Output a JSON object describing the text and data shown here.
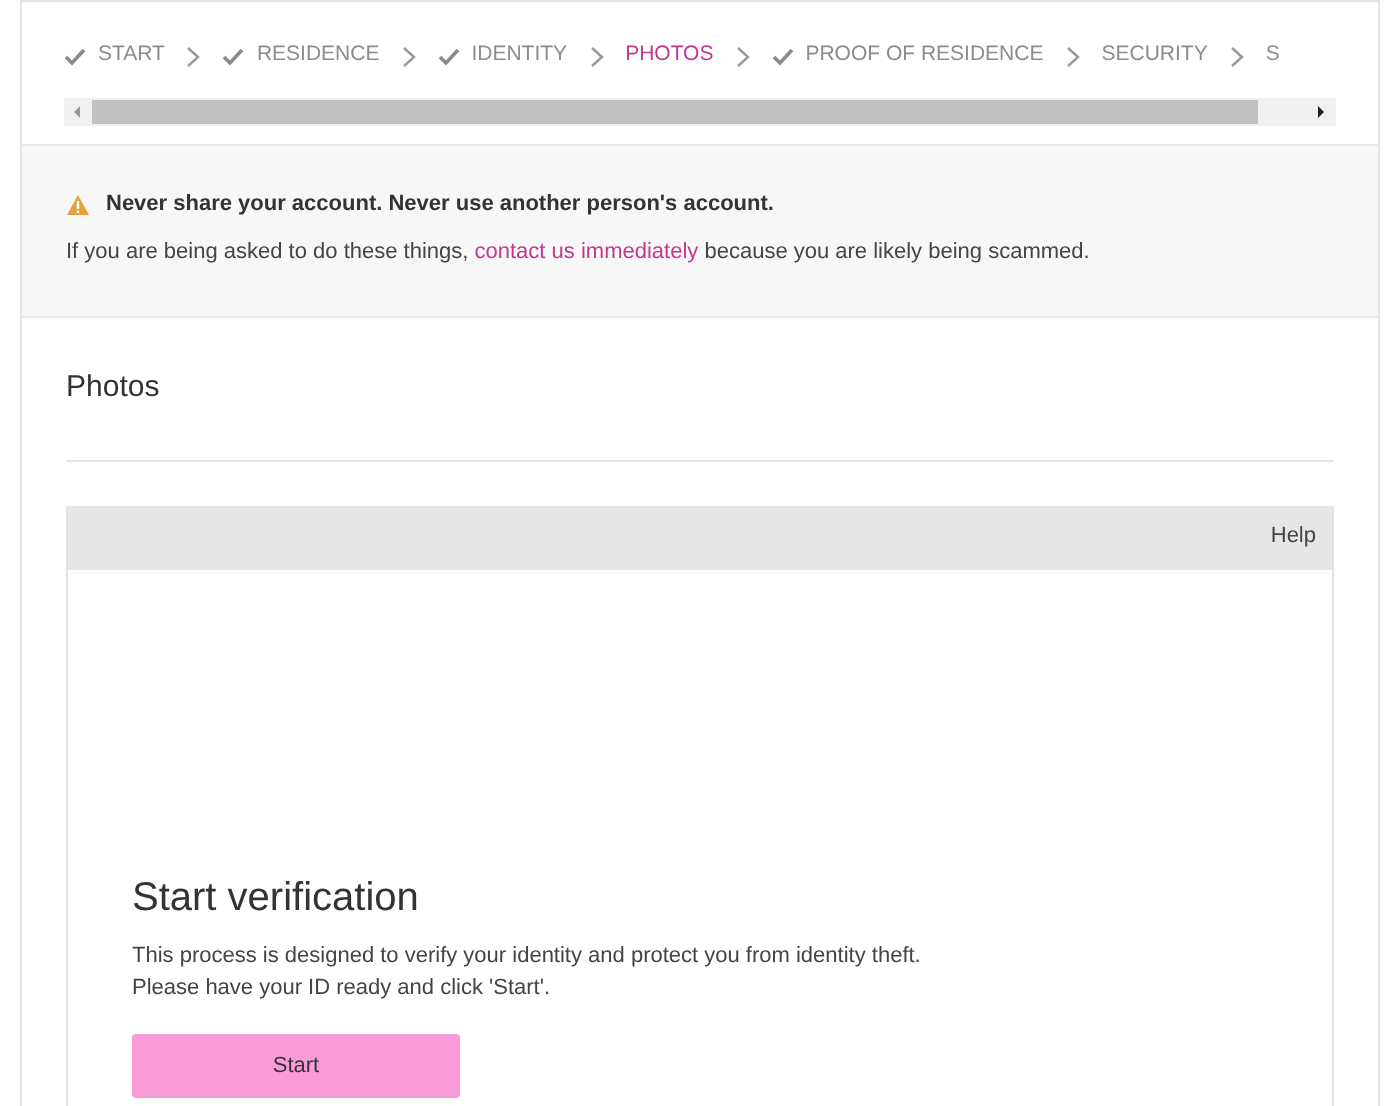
{
  "steps": [
    {
      "label": "START",
      "checked": true,
      "selected": false
    },
    {
      "label": "RESIDENCE",
      "checked": true,
      "selected": false
    },
    {
      "label": "IDENTITY",
      "checked": true,
      "selected": false
    },
    {
      "label": "PHOTOS",
      "checked": false,
      "selected": true
    },
    {
      "label": "PROOF OF RESIDENCE",
      "checked": true,
      "selected": false
    },
    {
      "label": "SECURITY",
      "checked": false,
      "selected": false
    },
    {
      "label": "S",
      "checked": false,
      "selected": false
    }
  ],
  "warning": {
    "title": "Never share your account. Never use another person's account.",
    "text_before": "If you are being asked to do these things,",
    "link": "contact us immediately",
    "text_after": "because you are likely being scammed."
  },
  "section_title": "Photos",
  "verification": {
    "help": "Help",
    "title": "Start verification",
    "text": "This process is designed to verify your identity and protect you from identity theft.\nPlease have your ID ready and click 'Start'.",
    "button": "Start"
  }
}
